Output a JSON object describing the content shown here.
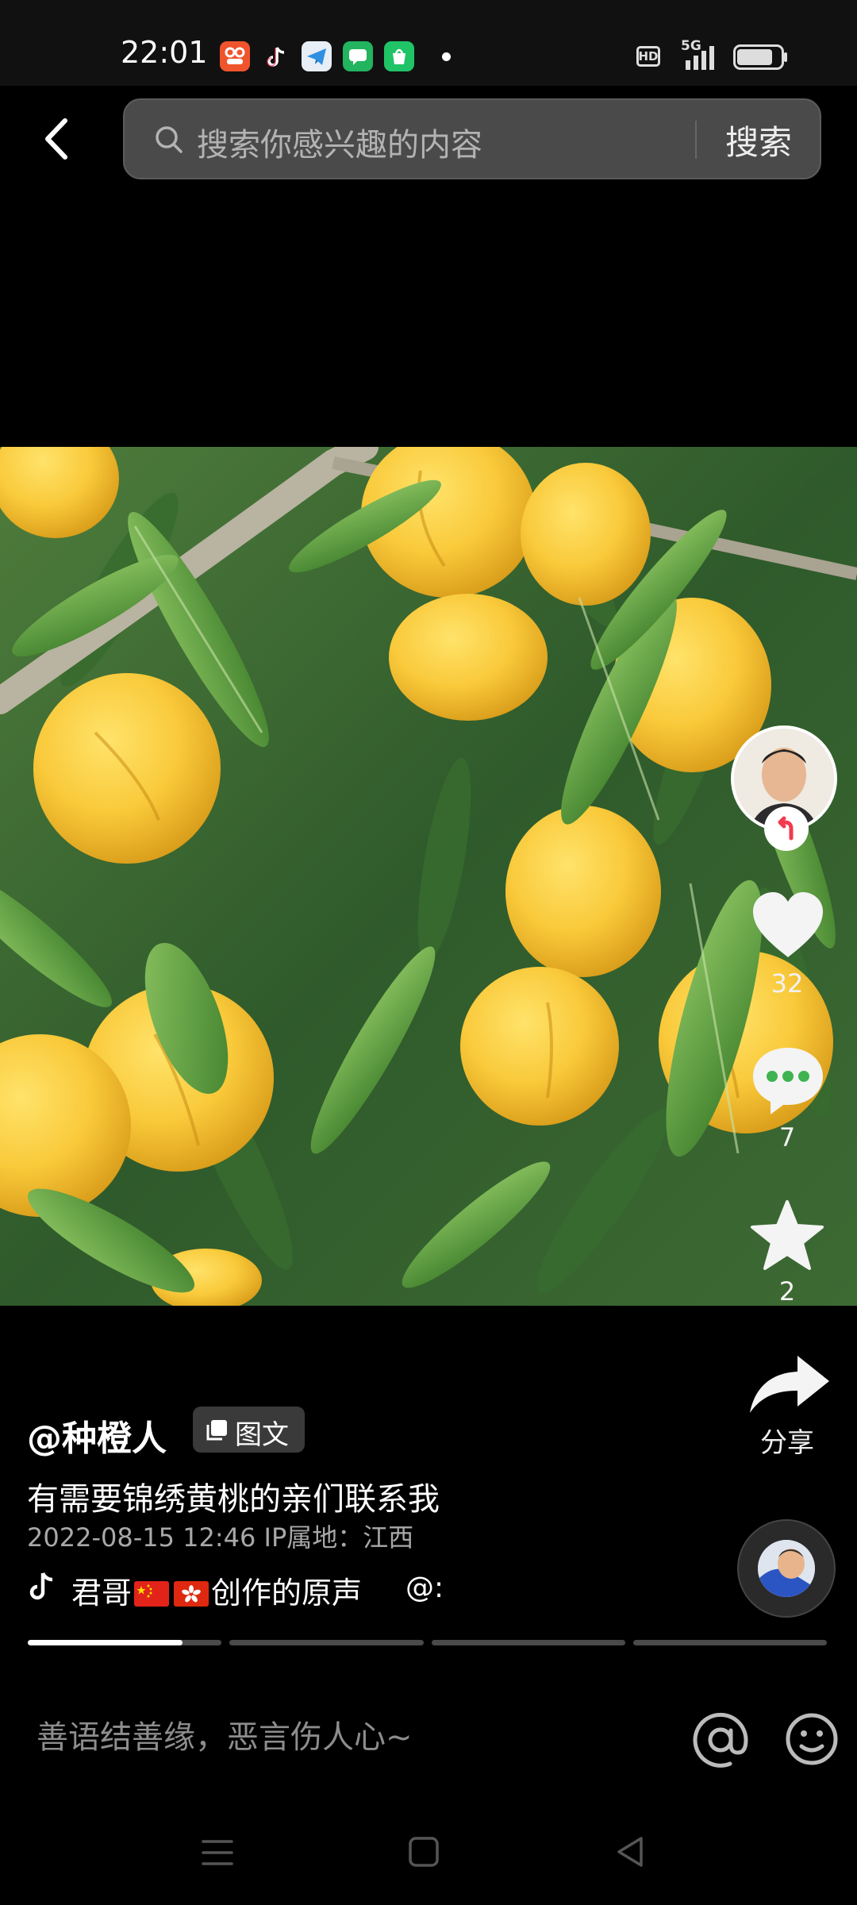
{
  "status_bar": {
    "time": "22:01",
    "hd": "HD",
    "network": "5G",
    "app_icons": [
      "app-icon-orange",
      "tiktok-icon",
      "telegram-icon",
      "messages-icon",
      "shopping-icon"
    ]
  },
  "search": {
    "placeholder": "搜索你感兴趣的内容",
    "button": "搜索"
  },
  "actions": {
    "likes": "32",
    "comments": "7",
    "favorites": "2",
    "share": "分享"
  },
  "post": {
    "author": "@种橙人",
    "type_badge": "图文",
    "caption": "有需要锦绣黄桃的亲们联系我",
    "meta": "2022-08-15 12:46  IP属地：江西"
  },
  "music": {
    "artist": "君哥",
    "suffix": "创作的原声",
    "mention": "@:"
  },
  "gallery": {
    "image_count": 4,
    "current_index": 1,
    "current_progress": 0.8
  },
  "comment": {
    "placeholder": "善语结善缘，恶言伤人心~"
  },
  "colors": {
    "background": "#000000",
    "search_bar": "#4a4a4a",
    "like_white": "#ffffff",
    "comment_dots": "#3fb34f",
    "follow_red": "#f23a4f"
  }
}
